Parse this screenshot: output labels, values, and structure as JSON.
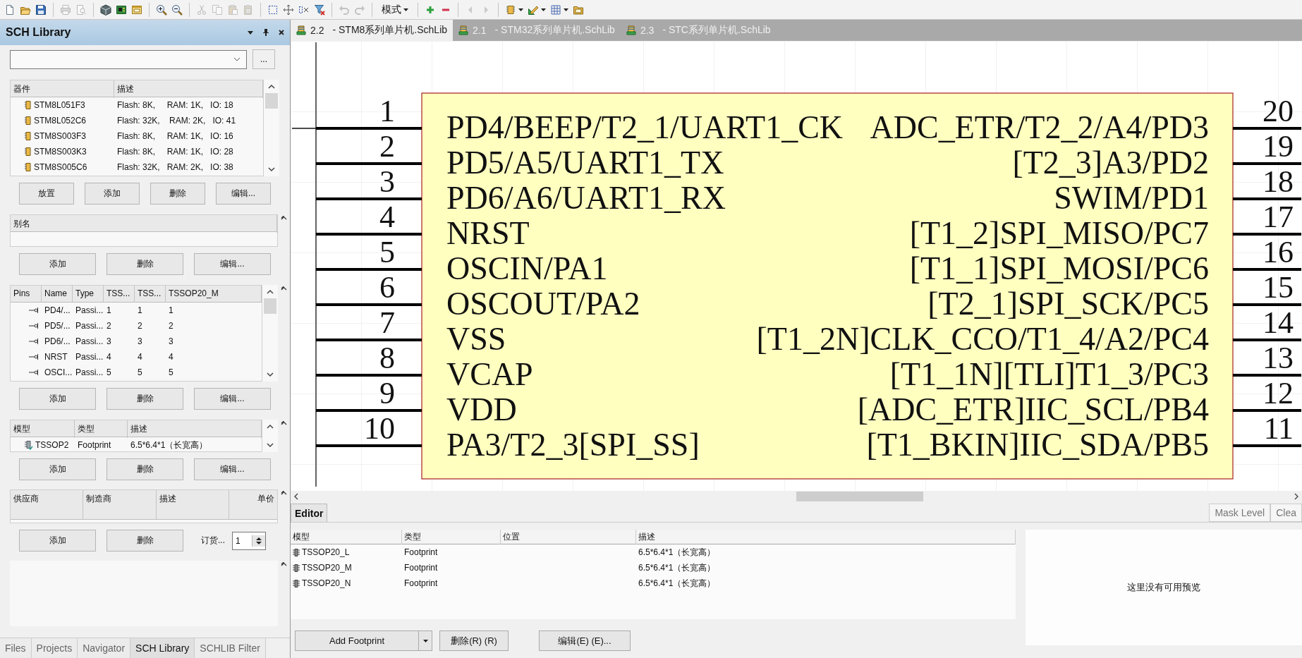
{
  "toolbar": [
    {
      "kind": "new",
      "disabled": false
    },
    {
      "kind": "open",
      "disabled": false
    },
    {
      "kind": "save",
      "disabled": false
    },
    {
      "kind": "separator"
    },
    {
      "kind": "print",
      "disabled": true
    },
    {
      "kind": "preview",
      "disabled": true
    },
    {
      "kind": "separator"
    },
    {
      "kind": "cube",
      "disabled": false
    },
    {
      "kind": "board",
      "disabled": false
    },
    {
      "kind": "window",
      "disabled": false
    },
    {
      "kind": "separator"
    },
    {
      "kind": "zoom-in",
      "disabled": false
    },
    {
      "kind": "zoom-out",
      "disabled": false
    },
    {
      "kind": "separator"
    },
    {
      "kind": "cut",
      "disabled": true
    },
    {
      "kind": "copy",
      "disabled": true
    },
    {
      "kind": "paste",
      "disabled": true
    },
    {
      "kind": "paste-special",
      "disabled": true
    },
    {
      "kind": "separator"
    },
    {
      "kind": "select-rect",
      "disabled": false
    },
    {
      "kind": "move",
      "disabled": false
    },
    {
      "kind": "deselect",
      "disabled": false
    },
    {
      "kind": "filter-clear",
      "disabled": false
    },
    {
      "kind": "separator"
    },
    {
      "kind": "undo",
      "disabled": true
    },
    {
      "kind": "redo",
      "disabled": true
    },
    {
      "kind": "separator"
    },
    {
      "kind": "menu",
      "label": "模式"
    },
    {
      "kind": "separator"
    },
    {
      "kind": "add",
      "disabled": false
    },
    {
      "kind": "remove",
      "disabled": false
    },
    {
      "kind": "separator"
    },
    {
      "kind": "back",
      "disabled": true
    },
    {
      "kind": "forward",
      "disabled": true
    },
    {
      "kind": "separator"
    },
    {
      "kind": "chip",
      "disabled": false
    },
    {
      "kind": "pencil-ruler",
      "disabled": false
    },
    {
      "kind": "grid",
      "disabled": false
    },
    {
      "kind": "folder",
      "disabled": false
    }
  ],
  "panel": {
    "title": "SCH Library",
    "browse_button": "...",
    "components": {
      "columns": [
        "器件",
        "描述"
      ],
      "rows": [
        {
          "name": "STM8L051F3",
          "description": "Flash: 8K,     RAM: 1K,   IO: 18"
        },
        {
          "name": "STM8L052C6",
          "description": "Flash: 32K,    RAM: 2K,   IO: 41"
        },
        {
          "name": "STM8S003F3",
          "description": "Flash: 8K,     RAM: 1K,   IO: 16"
        },
        {
          "name": "STM8S003K3",
          "description": "Flash: 8K,     RAM: 1K,   IO: 28"
        },
        {
          "name": "STM8S005C6",
          "description": "Flash: 32K,   RAM: 2K,   IO: 38"
        }
      ],
      "buttons": [
        "放置",
        "添加",
        "删除",
        "编辑..."
      ]
    },
    "aliases": {
      "columns": [
        "别名"
      ],
      "buttons": [
        "添加",
        "删除",
        "编辑..."
      ]
    },
    "pins": {
      "columns": [
        "Pins",
        "Name",
        "Type",
        "TSS...",
        "TSS...",
        "TSSOP20_M"
      ],
      "rows": [
        [
          "",
          "PD4/...",
          "Passi...",
          "1",
          "1",
          "1"
        ],
        [
          "",
          "PD5/...",
          "Passi...",
          "2",
          "2",
          "2"
        ],
        [
          "",
          "PD6/...",
          "Passi...",
          "3",
          "3",
          "3"
        ],
        [
          "",
          "NRST",
          "Passi...",
          "4",
          "4",
          "4"
        ],
        [
          "",
          "OSCI...",
          "Passi...",
          "5",
          "5",
          "5"
        ]
      ],
      "buttons": [
        "添加",
        "删除",
        "编辑..."
      ]
    },
    "models": {
      "columns": [
        "模型",
        "类型",
        "描述"
      ],
      "rows": [
        [
          "TSSOP2",
          "Footprint",
          "6.5*6.4*1（长宽高）"
        ]
      ],
      "buttons": [
        "添加",
        "删除",
        "编辑..."
      ]
    },
    "suppliers": {
      "columns": [
        "供应商",
        "制造商",
        "描述",
        "单价"
      ],
      "buttons": [
        "添加",
        "删除"
      ],
      "order_label": "订货...",
      "order_quantity": "1"
    },
    "tabs": [
      {
        "label": "Files",
        "selected": false
      },
      {
        "label": "Projects",
        "selected": false
      },
      {
        "label": "Navigator",
        "selected": false
      },
      {
        "label": "SCH Library",
        "selected": true
      },
      {
        "label": "SCHLIB Filter",
        "selected": false
      }
    ]
  },
  "documents": [
    {
      "number": "2.2",
      "title": "- STM8系列单片机.SchLib",
      "selected": true
    },
    {
      "number": "2.1",
      "title": "- STM32系列单片机.SchLib",
      "selected": false
    },
    {
      "number": "2.3",
      "title": "- STC系列单片机.SchLib",
      "selected": false
    }
  ],
  "schematic": {
    "left_pins": [
      {
        "number": "1",
        "name": "PD4/BEEP/T2_1/UART1_CK"
      },
      {
        "number": "2",
        "name": "PD5/A5/UART1_TX"
      },
      {
        "number": "3",
        "name": "PD6/A6/UART1_RX"
      },
      {
        "number": "4",
        "name": "NRST"
      },
      {
        "number": "5",
        "name": "OSCIN/PA1"
      },
      {
        "number": "6",
        "name": "OSCOUT/PA2"
      },
      {
        "number": "7",
        "name": "VSS"
      },
      {
        "number": "8",
        "name": "VCAP"
      },
      {
        "number": "9",
        "name": "VDD"
      },
      {
        "number": "10",
        "name": "PA3/T2_3[SPI_SS]"
      }
    ],
    "right_pins": [
      {
        "number": "20",
        "name": "ADC_ETR/T2_2/A4/PD3"
      },
      {
        "number": "19",
        "name": "[T2_3]A3/PD2"
      },
      {
        "number": "18",
        "name": "SWIM/PD1"
      },
      {
        "number": "17",
        "name": "[T1_2]SPI_MISO/PC7"
      },
      {
        "number": "16",
        "name": "[T1_1]SPI_MOSI/PC6"
      },
      {
        "number": "15",
        "name": "[T2_1]SPI_SCK/PC5"
      },
      {
        "number": "14",
        "name": "[T1_2N]CLK_CCO/T1_4/A2/PC4"
      },
      {
        "number": "13",
        "name": "[T1_1N][TLI]T1_3/PC3"
      },
      {
        "number": "12",
        "name": "[ADC_ETR]IIC_SCL/PB4"
      },
      {
        "number": "11",
        "name": "[T1_BKIN]IIC_SDA/PB5"
      }
    ]
  },
  "editor": {
    "tab": "Editor",
    "right_tabs": [
      "Mask Level",
      "Clea"
    ],
    "columns": [
      "模型",
      "类型",
      "位置",
      "描述"
    ],
    "rows": [
      [
        "TSSOP20_L",
        "Footprint",
        "",
        "6.5*6.4*1（长宽高）"
      ],
      [
        "TSSOP20_M",
        "Footprint",
        "",
        "6.5*6.4*1（长宽高）"
      ],
      [
        "TSSOP20_N",
        "Footprint",
        "",
        "6.5*6.4*1（长宽高）"
      ]
    ],
    "preview_text": "这里没有可用预览",
    "buttons": [
      "Add Footprint",
      "删除(R) (R)",
      "编辑(E) (E)..."
    ]
  }
}
